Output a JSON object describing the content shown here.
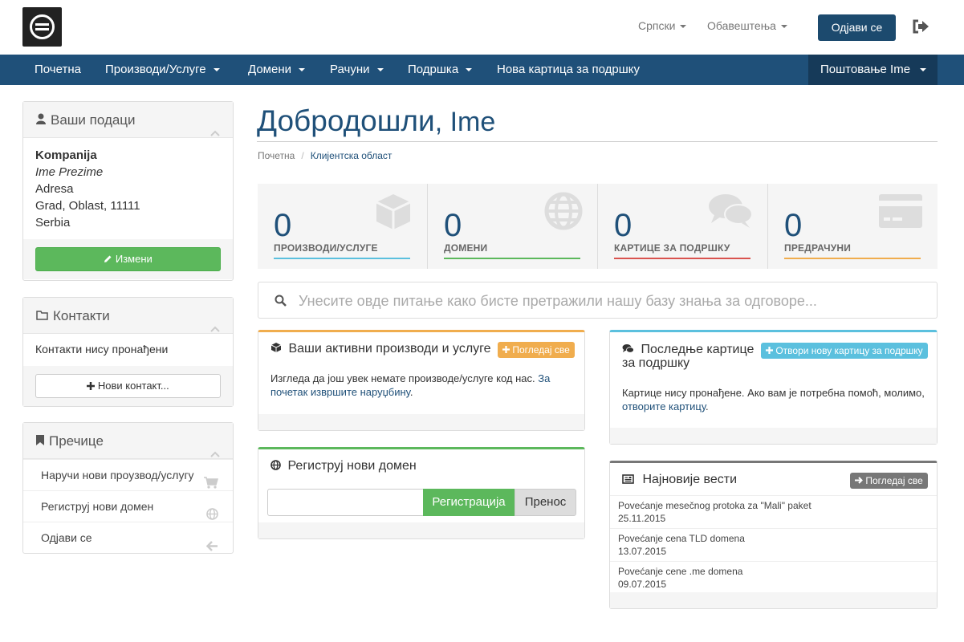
{
  "header": {
    "language": "Српски",
    "notifications": "Обавештења",
    "logout_label": "Одјави се"
  },
  "nav": {
    "items": [
      "Почетна",
      "Производи/Услуге",
      "Домени",
      "Рачуни",
      "Подршка",
      "Нова картица за подршку"
    ],
    "account": "Поштовање Ime"
  },
  "sidebar": {
    "info": {
      "title": "Ваши подаци",
      "company": "Kompanija",
      "name": "Ime Prezime",
      "address": "Adresa",
      "city": "Grad, Oblast, 11111",
      "country": "Serbia",
      "edit_label": "Измени"
    },
    "contacts": {
      "title": "Контакти",
      "empty": "Контакти нису пронађени",
      "new_label": "Нови контакт..."
    },
    "shortcuts": {
      "title": "Пречице",
      "items": [
        "Наручи нови проузвод/услугу",
        "Региструј нови домен",
        "Одјави се"
      ]
    }
  },
  "main": {
    "welcome": "Добродошли",
    "welcome_name": ", Ime",
    "breadcrumb": [
      "Почетна",
      "Клијентска област"
    ],
    "tiles": [
      {
        "count": "0",
        "label": "ПРОИЗВОДИ/УСЛУГЕ",
        "color": "#5bc0de"
      },
      {
        "count": "0",
        "label": "ДОМЕНИ",
        "color": "#5cb85c"
      },
      {
        "count": "0",
        "label": "КАРТИЦЕ ЗА ПОДРШКУ",
        "color": "#d9534f"
      },
      {
        "count": "0",
        "label": "ПРЕДРАЧУНИ",
        "color": "#f0ad4e"
      }
    ],
    "kb_placeholder": "Унесите овде питање како бисте претражили нашу базу знања за одговоре...",
    "products": {
      "title": "Ваши активни производи и услуге",
      "view_all": "Погледај све",
      "text": "Изгледа да још увек немате производе/услуге код нас.",
      "link": "За почетак извршите наруџбину",
      "accent": "#f0ad4e"
    },
    "domain": {
      "title": "Региструј нови домен",
      "register": "Регистрација",
      "transfer": "Пренос",
      "accent": "#5cb85c"
    },
    "tickets": {
      "title_1": "Последње картице",
      "title_2": "за подршку",
      "open_new": "Отвори нову картицу за подршку",
      "text": "Картице нису пронађене. Ако вам је потребна помоћ, молимо,",
      "link": "отворите картицу",
      "accent": "#5bc0de"
    },
    "news": {
      "title": "Најновије вести",
      "view_all": "Погледај све",
      "items": [
        {
          "title": "Povećanje mesečnog protoka za \"Mali\" paket",
          "date": "25.11.2015"
        },
        {
          "title": "Povećanje cena TLD domena",
          "date": "13.07.2015"
        },
        {
          "title": "Povećanje cene .me domena",
          "date": "09.07.2015"
        }
      ],
      "accent": "#777777"
    }
  }
}
